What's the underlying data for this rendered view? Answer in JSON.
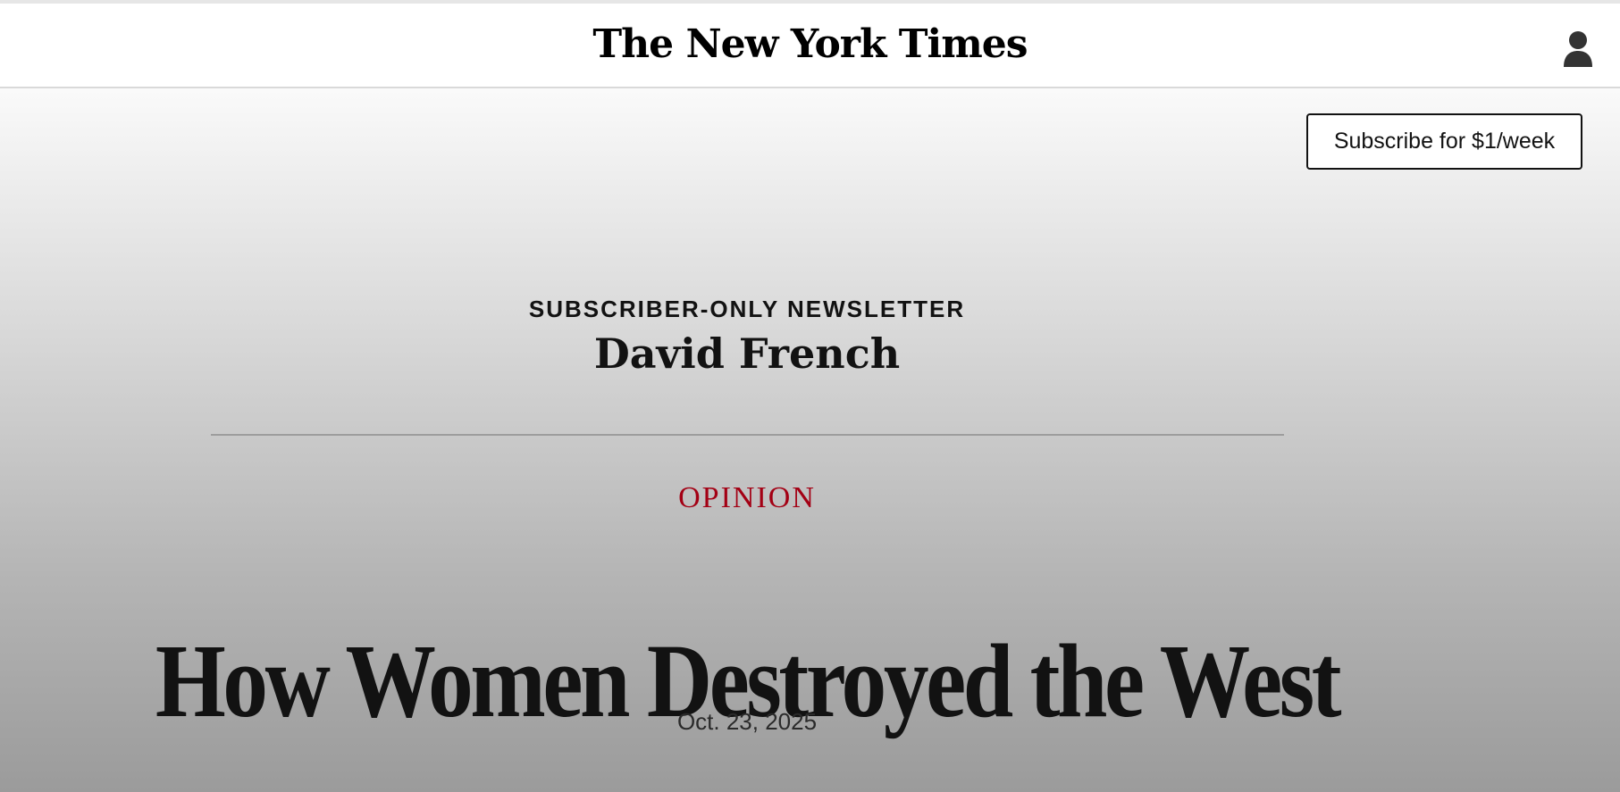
{
  "header": {
    "logo_text": "The New York Times",
    "account_icon": "user-silhouette-icon"
  },
  "hero": {
    "subscribe_label": "Subscribe for $1/week",
    "kicker": "SUBSCRIBER-ONLY NEWSLETTER",
    "newsletter_name": "David French",
    "section": "OPINION",
    "headline": "How Women Destroyed the West",
    "date": "Oct. 23, 2025"
  },
  "colors": {
    "section_accent": "#a30014",
    "text": "#121212"
  }
}
